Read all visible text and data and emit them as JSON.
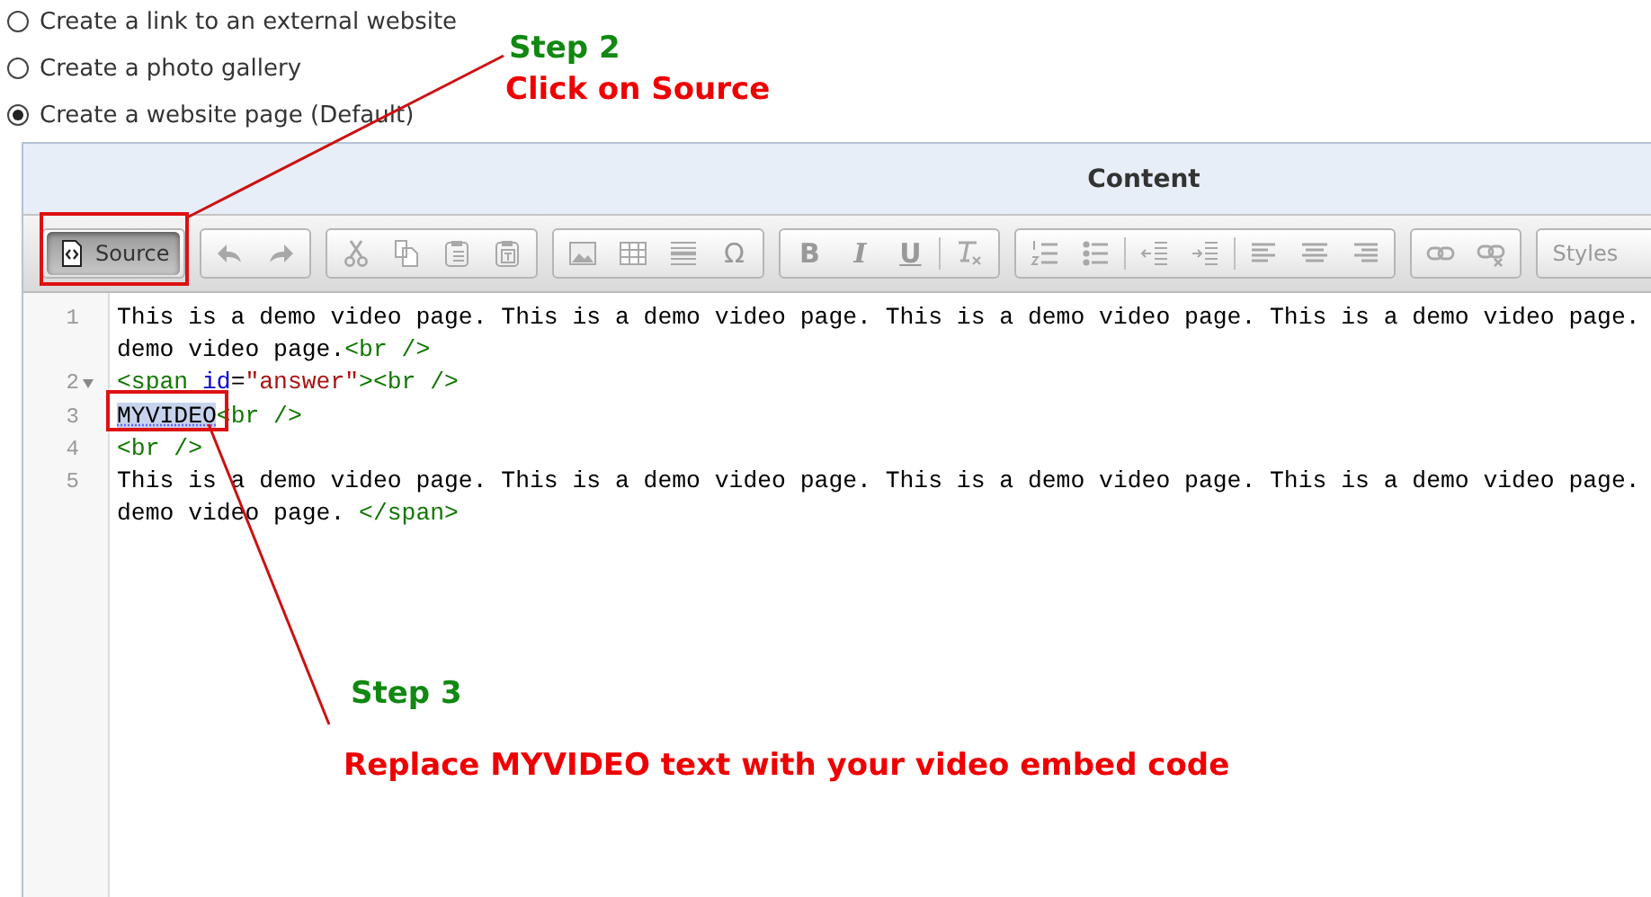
{
  "radios": [
    {
      "label": "Create a link to an external website",
      "selected": false
    },
    {
      "label": "Create a photo gallery",
      "selected": false
    },
    {
      "label": "Create a website page (Default)",
      "selected": true
    }
  ],
  "editor": {
    "title": "Content",
    "toolbar": [
      [
        {
          "kind": "source",
          "label": "Source",
          "on": true,
          "disabled": false
        }
      ],
      [
        {
          "kind": "undo",
          "on": false,
          "disabled": true
        },
        {
          "kind": "redo",
          "on": false,
          "disabled": true
        }
      ],
      [
        {
          "kind": "cut",
          "on": false,
          "disabled": true
        },
        {
          "kind": "copy",
          "on": false,
          "disabled": true
        },
        {
          "kind": "paste",
          "on": false,
          "disabled": true
        },
        {
          "kind": "paste-text",
          "on": false,
          "disabled": true
        }
      ],
      [
        {
          "kind": "image",
          "on": false,
          "disabled": true
        },
        {
          "kind": "table",
          "on": false,
          "disabled": true
        },
        {
          "kind": "rule",
          "on": false,
          "disabled": true
        },
        {
          "kind": "glyph",
          "label": "Ω",
          "on": false,
          "disabled": true
        }
      ],
      [
        {
          "kind": "glyph",
          "label": "B",
          "on": false,
          "disabled": true
        },
        {
          "kind": "glyph",
          "label": "I",
          "on": false,
          "disabled": true
        },
        {
          "kind": "glyph",
          "label": "U",
          "on": false,
          "disabled": true
        },
        {
          "kind": "separator"
        },
        {
          "kind": "clear-format",
          "on": false,
          "disabled": true
        }
      ],
      [
        {
          "kind": "numbered-list",
          "on": false,
          "disabled": true
        },
        {
          "kind": "bullet-list",
          "on": false,
          "disabled": true
        },
        {
          "kind": "separator"
        },
        {
          "kind": "outdent",
          "on": false,
          "disabled": true
        },
        {
          "kind": "indent",
          "on": false,
          "disabled": true
        },
        {
          "kind": "separator"
        },
        {
          "kind": "align-left",
          "on": false,
          "disabled": true
        },
        {
          "kind": "align-center",
          "on": false,
          "disabled": true
        },
        {
          "kind": "align-right",
          "on": false,
          "disabled": true
        }
      ],
      [
        {
          "kind": "link",
          "on": false,
          "disabled": true
        },
        {
          "kind": "unlink",
          "on": false,
          "disabled": true
        }
      ],
      [
        {
          "kind": "dropdown",
          "label": "Styles",
          "on": false,
          "disabled": true
        }
      ]
    ],
    "code_lines": [
      {
        "number": "1",
        "foldable": false,
        "rows": [
          [
            {
              "kind": "text",
              "text": "This is a demo video page. This is a demo video page. This is a demo video page. This is a demo video page."
            }
          ],
          [
            {
              "kind": "text",
              "text": "demo video page."
            },
            {
              "kind": "tag",
              "text": "<br />"
            }
          ]
        ]
      },
      {
        "number": "2",
        "foldable": true,
        "rows": [
          [
            {
              "kind": "tag",
              "text": "<span "
            },
            {
              "kind": "attr",
              "text": "id"
            },
            {
              "kind": "text",
              "text": "="
            },
            {
              "kind": "value",
              "text": "\"answer\""
            },
            {
              "kind": "tag",
              "text": "><br />"
            }
          ]
        ]
      },
      {
        "number": "3",
        "foldable": false,
        "rows": [
          [
            {
              "kind": "highlight",
              "text": "MYVIDEO"
            },
            {
              "kind": "tag",
              "text": "<br />"
            }
          ]
        ]
      },
      {
        "number": "4",
        "foldable": false,
        "rows": [
          [
            {
              "kind": "tag",
              "text": "<br />"
            }
          ]
        ]
      },
      {
        "number": "5",
        "foldable": false,
        "rows": [
          [
            {
              "kind": "text",
              "text": "This is a demo video page. This is a demo video page. This is a demo video page. This is a demo video page."
            }
          ],
          [
            {
              "kind": "text",
              "text": "demo video page. "
            },
            {
              "kind": "tag",
              "text": "</span>"
            }
          ]
        ]
      }
    ]
  },
  "callouts": [
    {
      "step": "Step 2",
      "instruction": "Click on Source"
    },
    {
      "step": "Step 3",
      "instruction": "Replace MYVIDEO text with your video embed code"
    }
  ]
}
